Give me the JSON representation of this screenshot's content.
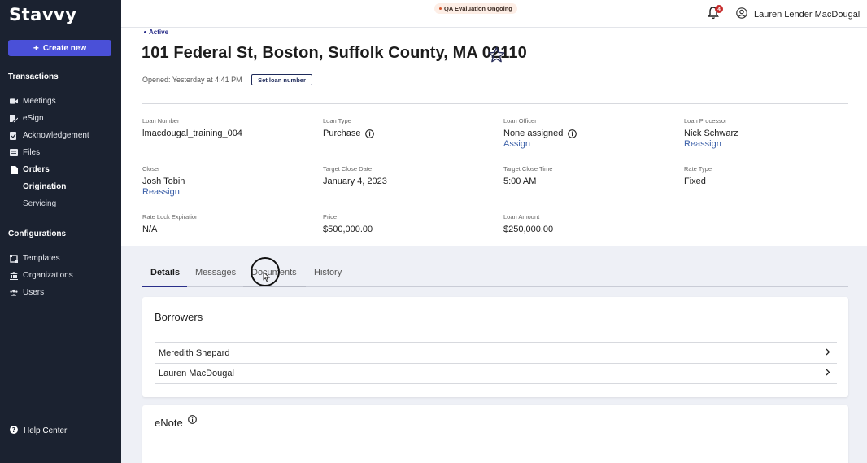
{
  "app": {
    "logo": "Stavvy"
  },
  "sidebar": {
    "create_label": "Create new",
    "transactions_heading": "Transactions",
    "items": [
      {
        "label": "Meetings",
        "icon": "video-icon"
      },
      {
        "label": "eSign",
        "icon": "signature-icon"
      },
      {
        "label": "Acknowledgement",
        "icon": "acknowledge-icon"
      },
      {
        "label": "Files",
        "icon": "files-icon"
      },
      {
        "label": "Orders",
        "icon": "orders-icon"
      }
    ],
    "sub_items": [
      {
        "label": "Origination",
        "active": true
      },
      {
        "label": "Servicing",
        "active": false
      }
    ],
    "configurations_heading": "Configurations",
    "config_items": [
      {
        "label": "Templates",
        "icon": "templates-icon"
      },
      {
        "label": "Organizations",
        "icon": "organizations-icon"
      },
      {
        "label": "Users",
        "icon": "users-icon"
      }
    ],
    "help_label": "Help Center"
  },
  "topbar": {
    "qa_badge": "QA Evaluation Ongoing",
    "notification_count": "4",
    "user_name": "Lauren Lender MacDougal"
  },
  "header": {
    "status": "Active",
    "title": "101 Federal St, Boston, Suffolk County, MA 02110",
    "opened": "Opened: Yesterday at 4:41 PM",
    "set_loan_label": "Set loan number"
  },
  "fields": {
    "loan_number": {
      "label": "Loan Number",
      "value": "lmacdougal_training_004"
    },
    "loan_type": {
      "label": "Loan Type",
      "value": "Purchase"
    },
    "loan_officer": {
      "label": "Loan Officer",
      "value": "None assigned",
      "link": "Assign"
    },
    "loan_processor": {
      "label": "Loan Processor",
      "value": "Nick Schwarz",
      "link": "Reassign"
    },
    "closer": {
      "label": "Closer",
      "value": "Josh Tobin",
      "link": "Reassign"
    },
    "target_close_date": {
      "label": "Target Close Date",
      "value": "January 4, 2023"
    },
    "target_close_time": {
      "label": "Target Close Time",
      "value": "5:00 AM"
    },
    "rate_type": {
      "label": "Rate Type",
      "value": "Fixed"
    },
    "rate_lock": {
      "label": "Rate Lock Expiration",
      "value": "N/A"
    },
    "price": {
      "label": "Price",
      "value": "$500,000.00"
    },
    "loan_amount": {
      "label": "Loan Amount",
      "value": "$250,000.00"
    }
  },
  "tabs": [
    {
      "label": "Details",
      "active": true
    },
    {
      "label": "Messages",
      "active": false
    },
    {
      "label": "Documents",
      "active": false
    },
    {
      "label": "History",
      "active": false
    }
  ],
  "borrowers": {
    "title": "Borrowers",
    "rows": [
      "Meredith Shepard",
      "Lauren MacDougal"
    ]
  },
  "enote": {
    "title": "eNote"
  },
  "colors": {
    "sidebar_bg": "#1b2230",
    "accent": "#4a50d8",
    "link": "#3a5fa8",
    "lower_bg": "#eef0f6"
  }
}
